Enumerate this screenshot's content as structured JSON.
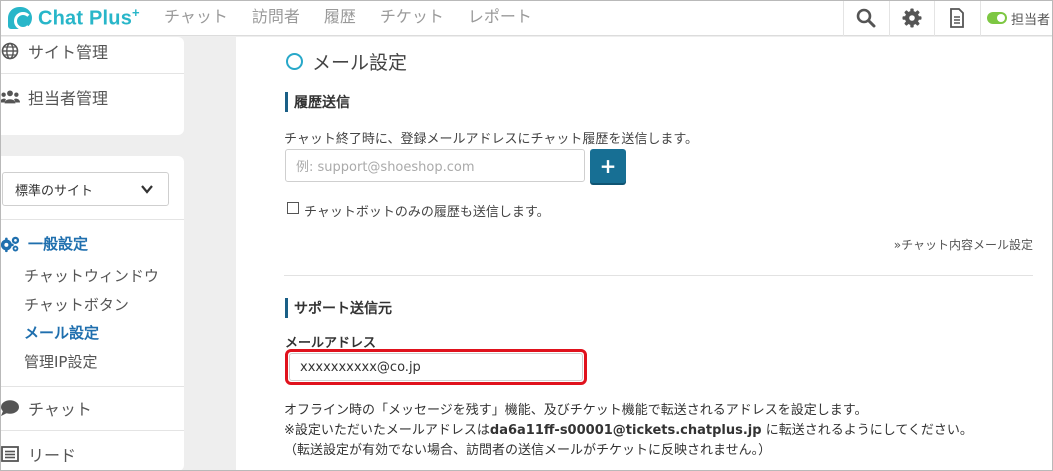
{
  "app": {
    "logo_text": "Chat Plus",
    "logo_plus": "+"
  },
  "topnav": {
    "items": [
      "チャット",
      "訪問者",
      "履歴",
      "チケット",
      "レポート"
    ]
  },
  "toolbar": {
    "icons": [
      "search-icon",
      "gear-icon",
      "document-icon"
    ],
    "status_toggle": "on",
    "user_label": "担当者"
  },
  "sidebar": {
    "top_items": [
      {
        "label": "サイト管理",
        "icon": "globe-icon"
      },
      {
        "label": "担当者管理",
        "icon": "users-icon"
      }
    ],
    "site_select": "標準のサイト",
    "section_label": "一般設定",
    "sub_items": [
      "チャットウィンドウ",
      "チャットボタン",
      "メール設定",
      "管理IP設定"
    ],
    "active_sub_item": "メール設定",
    "bottom_items": [
      {
        "label": "チャット",
        "icon": "speech-bubble-icon"
      },
      {
        "label": "リード",
        "icon": "list-icon"
      }
    ]
  },
  "main": {
    "page_title": "メール設定",
    "history_section": {
      "title": "履歴送信",
      "description": "チャット終了時に、登録メールアドレスにチャット履歴を送信します。",
      "email_placeholder": "例: support@shoeshop.com",
      "add_button_label": "+",
      "checkbox_label": "チャットボットのみの履歴も送信します。",
      "link_label": "»チャット内容メール設定"
    },
    "support_section": {
      "title": "サポート送信元",
      "field_label": "メールアドレス",
      "email_value": "xxxxxxxxxx@co.jp",
      "note_line1": "オフライン時の「メッセージを残す」機能、及びチケット機能で転送されるアドレスを設定します。",
      "note_line2_prefix": "※設定いただいたメールアドレスは",
      "note_line2_address": "da6a11ff-s00001@tickets.chatplus.jp",
      "note_line2_suffix": " に転送されるようにしてください。",
      "note_line3": "（転送設定が有効でない場合、訪問者の送信メールがチケットに反映されません。）"
    }
  },
  "colors": {
    "brand": "#28b6c9",
    "accent_blue": "#1f6fae",
    "button_blue": "#176f94",
    "highlight_red": "#e0121d",
    "toggle_green": "#7dc742"
  }
}
